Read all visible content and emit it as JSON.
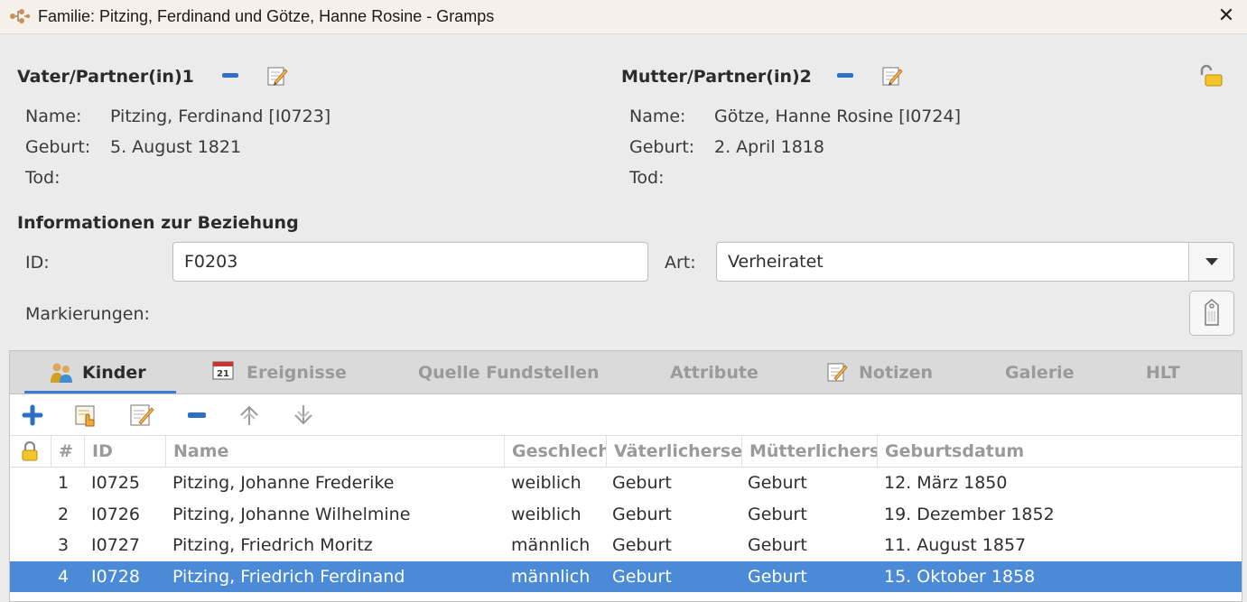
{
  "window": {
    "title": "Familie: Pitzing, Ferdinand und Götze, Hanne Rosine - Gramps",
    "close_glyph": "✕",
    "app_icon": "family-tree-icon"
  },
  "father": {
    "section_title": "Vater/Partner(in)1",
    "name_label": "Name:",
    "name_value": "Pitzing, Ferdinand [I0723]",
    "birth_label": "Geburt:",
    "birth_value": "5. August 1821",
    "death_label": "Tod:",
    "death_value": ""
  },
  "mother": {
    "section_title": "Mutter/Partner(in)2",
    "name_label": "Name:",
    "name_value": "Götze, Hanne Rosine [I0724]",
    "birth_label": "Geburt:",
    "birth_value": "2. April 1818",
    "death_label": "Tod:",
    "death_value": ""
  },
  "relationship": {
    "section_title": "Informationen zur Beziehung",
    "id_label": "ID:",
    "id_value": "F0203",
    "type_label": "Art:",
    "type_value": "Verheiratet",
    "tags_label": "Markierungen:"
  },
  "tabs": [
    {
      "label": "Kinder",
      "icon": "children-icon",
      "active": true
    },
    {
      "label": "Ereignisse",
      "icon": "calendar-icon",
      "active": false
    },
    {
      "label": "Quelle Fundstellen",
      "icon": "",
      "active": false
    },
    {
      "label": "Attribute",
      "icon": "",
      "active": false
    },
    {
      "label": "Notizen",
      "icon": "notes-icon",
      "active": false
    },
    {
      "label": "Galerie",
      "icon": "",
      "active": false
    },
    {
      "label": "HLT",
      "icon": "",
      "active": false
    }
  ],
  "toolbar": [
    "add-icon",
    "share-existing-icon",
    "edit-icon",
    "remove-icon",
    "move-up-icon",
    "move-down-icon"
  ],
  "children_table": {
    "columns": [
      "",
      "#",
      "ID",
      "Name",
      "Geschlecht",
      "Väterlicherseits",
      "Mütterlicherseits",
      "Geburtsdatum"
    ],
    "rows": [
      {
        "num": "1",
        "id": "I0725",
        "name": "Pitzing, Johanne Frederike",
        "gender": "weiblich",
        "paternal": "Geburt",
        "maternal": "Geburt",
        "birth": "12. März 1850",
        "selected": false
      },
      {
        "num": "2",
        "id": "I0726",
        "name": "Pitzing, Johanne Wilhelmine",
        "gender": "weiblich",
        "paternal": "Geburt",
        "maternal": "Geburt",
        "birth": "19. Dezember 1852",
        "selected": false
      },
      {
        "num": "3",
        "id": "I0727",
        "name": "Pitzing, Friedrich Moritz",
        "gender": "männlich",
        "paternal": "Geburt",
        "maternal": "Geburt",
        "birth": "11. August 1857",
        "selected": false
      },
      {
        "num": "4",
        "id": "I0728",
        "name": "Pitzing, Friedrich Ferdinand",
        "gender": "männlich",
        "paternal": "Geburt",
        "maternal": "Geburt",
        "birth": "15. Oktober 1858",
        "selected": true
      }
    ]
  },
  "colors": {
    "accent": "#3d7bd6",
    "selection": "#4a8ad6",
    "remove_blue": "#2e6fc4"
  }
}
